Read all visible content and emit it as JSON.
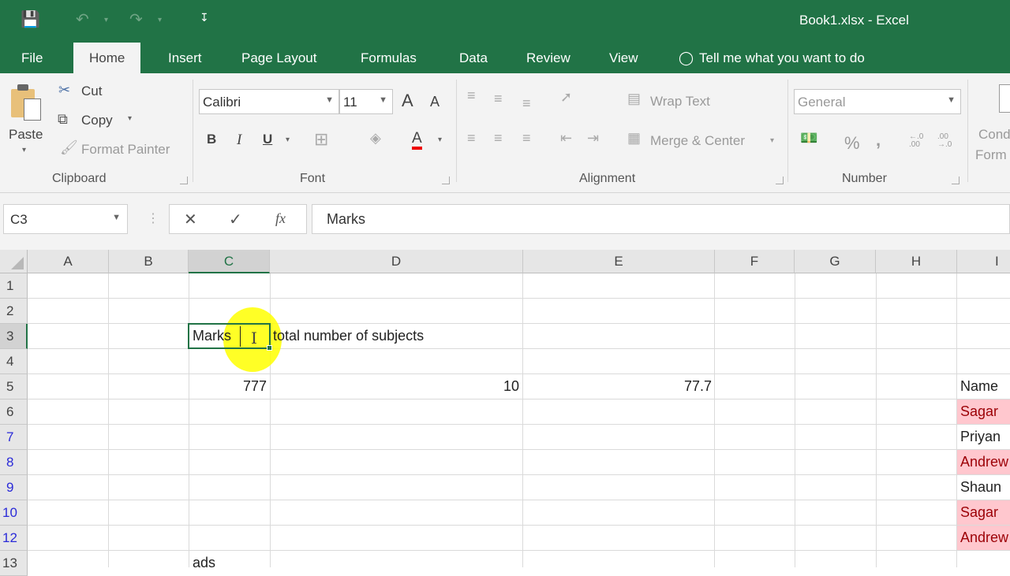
{
  "window": {
    "title": "Book1.xlsx - Excel"
  },
  "quick_access": {
    "save": "save-icon",
    "undo": "undo-icon",
    "redo": "redo-icon",
    "customize": "customize-icon"
  },
  "tabs": [
    "File",
    "Home",
    "Insert",
    "Page Layout",
    "Formulas",
    "Data",
    "Review",
    "View"
  ],
  "tell_me": "Tell me what you want to do",
  "ribbon": {
    "clipboard": {
      "paste": "Paste",
      "cut": "Cut",
      "copy": "Copy",
      "format_painter": "Format Painter",
      "label": "Clipboard"
    },
    "font": {
      "name": "Calibri",
      "size": "11",
      "bold": "B",
      "italic": "I",
      "underline": "U",
      "grow": "A",
      "shrink": "A",
      "font_color": "A",
      "label": "Font"
    },
    "alignment": {
      "wrap_text": "Wrap Text",
      "merge_center": "Merge & Center",
      "label": "Alignment"
    },
    "number": {
      "format": "General",
      "percent": "%",
      "comma": ",",
      "inc_decimal": "←.0 .00",
      "dec_decimal": ".00 →.0",
      "label": "Number"
    },
    "styles": {
      "conditional_line1": "Cond",
      "conditional_line2": "Form"
    }
  },
  "formula_bar": {
    "name_box": "C3",
    "cancel": "✕",
    "enter": "✓",
    "fx": "fx",
    "content": "Marks"
  },
  "columns": [
    "A",
    "B",
    "C",
    "D",
    "E",
    "F",
    "G",
    "H",
    "I"
  ],
  "rows": [
    "1",
    "2",
    "3",
    "4",
    "5",
    "6",
    "7",
    "8",
    "9",
    "10",
    "12",
    "13"
  ],
  "cells": {
    "C3": "Marks",
    "D3": "total number of subjects",
    "C5": "777",
    "D5": "10",
    "E5": "77.7",
    "I5": "Name",
    "I6": "Sagar",
    "I7": "Priyan",
    "I8": "Andrew",
    "I9": "Shaun",
    "I10": "Sagar",
    "I12": "Andrew",
    "C13": "ads"
  },
  "colors": {
    "accent": "#217346",
    "bad_fill": "#ffc7ce",
    "bad_text": "#9c0006",
    "filtered_row": "#2b2bd8"
  }
}
